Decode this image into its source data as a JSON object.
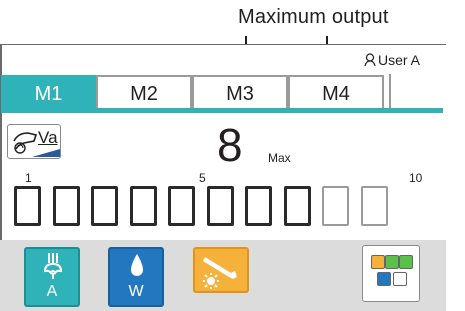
{
  "annotation": {
    "text": "Maximum output"
  },
  "user": {
    "label": "User A"
  },
  "tabs": [
    {
      "label": "M1",
      "active": true
    },
    {
      "label": "M2",
      "active": false
    },
    {
      "label": "M3",
      "active": false
    },
    {
      "label": "M4",
      "active": false
    }
  ],
  "mode": {
    "label": "Va",
    "icon": "handpiece-icon"
  },
  "output": {
    "value": "8",
    "max_label": "Max"
  },
  "scale": {
    "tick_labels": [
      "1",
      "5",
      "10"
    ],
    "total": 10,
    "max_level": 8
  },
  "buttons": {
    "air": {
      "label": "A",
      "icon": "air-icon"
    },
    "water": {
      "label": "W",
      "icon": "water-drop-icon"
    },
    "light": {
      "icon": "light-handpiece-icon"
    },
    "settings": {
      "icon": "settings-panel-icon"
    }
  },
  "colors": {
    "teal": "#2fb3b8",
    "blue": "#2377bf",
    "orange": "#f6b13a"
  }
}
